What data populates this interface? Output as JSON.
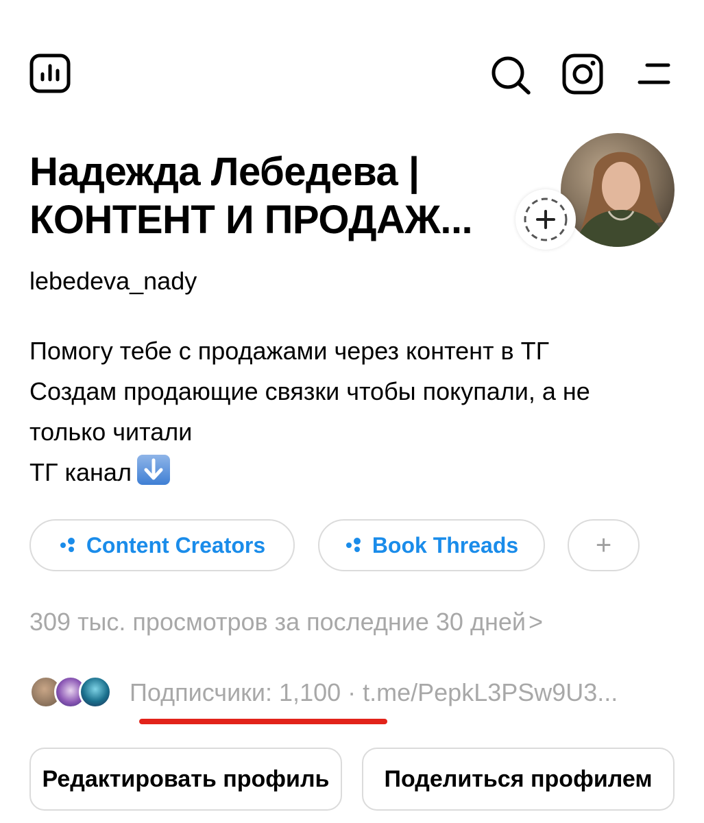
{
  "header": {
    "left_icon": "insights-chart-icon",
    "right_icons": [
      "search-icon",
      "instagram-icon",
      "menu-icon"
    ]
  },
  "profile": {
    "name_line1": "Надежда Лебедева |",
    "name_line2": "КОНТЕНТ И ПРОДАЖ...",
    "username": "lebedeva_nady",
    "avatar_icon": "profile-photo",
    "story_add_icon": "plus-icon"
  },
  "bio": {
    "lines": [
      "Помогу тебе с продажами через контент в ТГ",
      "Создам продающие связки чтобы покупали, а не",
      "только читали",
      "ТГ канал"
    ],
    "emoji": "arrow-down-emoji"
  },
  "communities": {
    "items": [
      {
        "label": "Content Creators"
      },
      {
        "label": "Book Threads"
      }
    ],
    "add_label": "+",
    "accent_color": "#1a8cea"
  },
  "stats": {
    "views_text": "309 тыс. просмотров за последние 30 дней",
    "views_chevron": ">",
    "followers_text": "Подписчики: 1,100 · t.me/PepkL3PSw9U3..."
  },
  "actions": {
    "edit_label": "Редактировать профиль",
    "share_label": "Поделиться профилем"
  },
  "colors": {
    "underline": "#e2231a",
    "muted_text": "#a8a8a8",
    "border": "#dbdbdb"
  }
}
